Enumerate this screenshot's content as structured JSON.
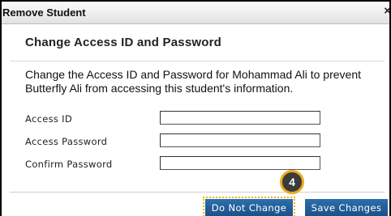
{
  "dialog": {
    "title": "Remove Student",
    "close_glyph": "×",
    "heading": "Change Access ID and Password",
    "description": "Change the Access ID and Password for Mohammad Ali to prevent Butterfly Ali from accessing this student's information."
  },
  "form": {
    "access_id_label": "Access ID",
    "access_id_value": "",
    "access_password_label": "Access Password",
    "access_password_value": "",
    "confirm_password_label": "Confirm Password",
    "confirm_password_value": ""
  },
  "buttons": {
    "do_not_change": "Do Not Change",
    "save_changes": "Save Changes"
  },
  "step_badge": "4",
  "colors": {
    "button_blue": "#1f5c97",
    "highlight": "#e8ad1c"
  }
}
